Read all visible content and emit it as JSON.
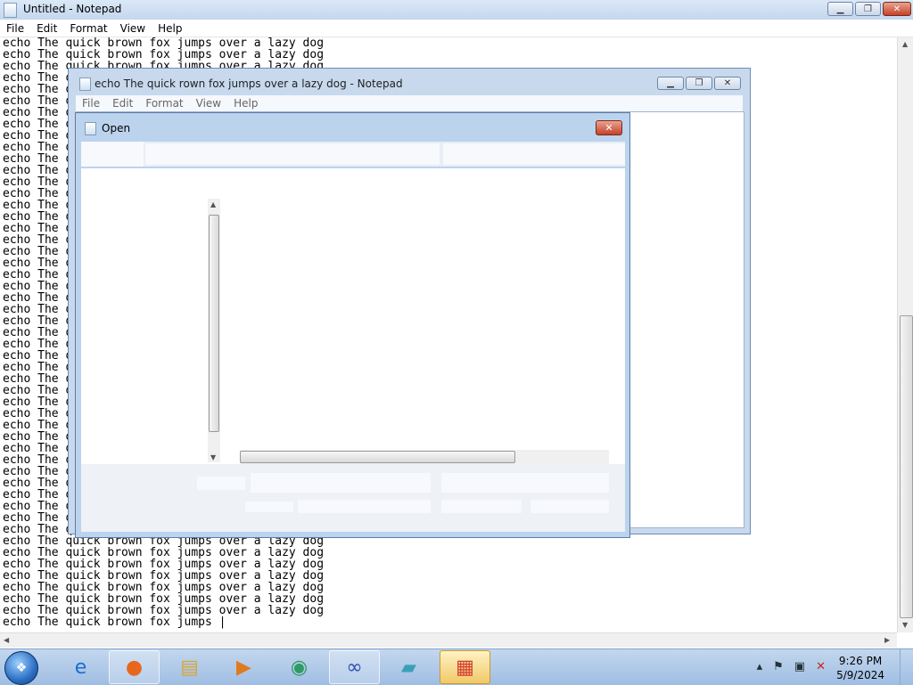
{
  "main_window": {
    "title": "Untitled - Notepad",
    "menu": [
      "File",
      "Edit",
      "View",
      "Format",
      "Help"
    ],
    "menu_order": [
      "File",
      "Edit",
      "Format",
      "View",
      "Help"
    ],
    "full_line": "echo The quick brown fox jumps over a lazy dog",
    "partial_line": "echo The quick brown fox jumps ",
    "short_line": "echo The"
  },
  "second_window": {
    "title": "echo The quick rown fox jumps over a lazy dog - Notepad",
    "menu": [
      "File",
      "Edit",
      "Format",
      "View",
      "Help"
    ]
  },
  "open_dialog": {
    "title": "Open",
    "close_glyph": "✕"
  },
  "caption_glyphs": {
    "minimize": "▁",
    "maximize": "❐",
    "close": "✕"
  },
  "taskbar": {
    "start_glyph": "❖",
    "items": [
      {
        "name": "internet-explorer",
        "glyph": "e",
        "color": "#1b6fd1"
      },
      {
        "name": "firefox",
        "glyph": "●",
        "color": "#e8661e"
      },
      {
        "name": "file-explorer",
        "glyph": "▤",
        "color": "#d8a634"
      },
      {
        "name": "media-player",
        "glyph": "▶",
        "color": "#e07a1f"
      },
      {
        "name": "app-green",
        "glyph": "◉",
        "color": "#2f9b63"
      },
      {
        "name": "app-infinity",
        "glyph": "∞",
        "color": "#2c4fb0"
      },
      {
        "name": "app-notes",
        "glyph": "▰",
        "color": "#3aa0b7"
      },
      {
        "name": "app-active",
        "glyph": "▦",
        "color": "#d33b2c"
      }
    ],
    "tray_icons": [
      "▴",
      "⚑",
      "▣",
      "✕"
    ],
    "time": "9:26 PM",
    "date": "5/9/2024"
  }
}
